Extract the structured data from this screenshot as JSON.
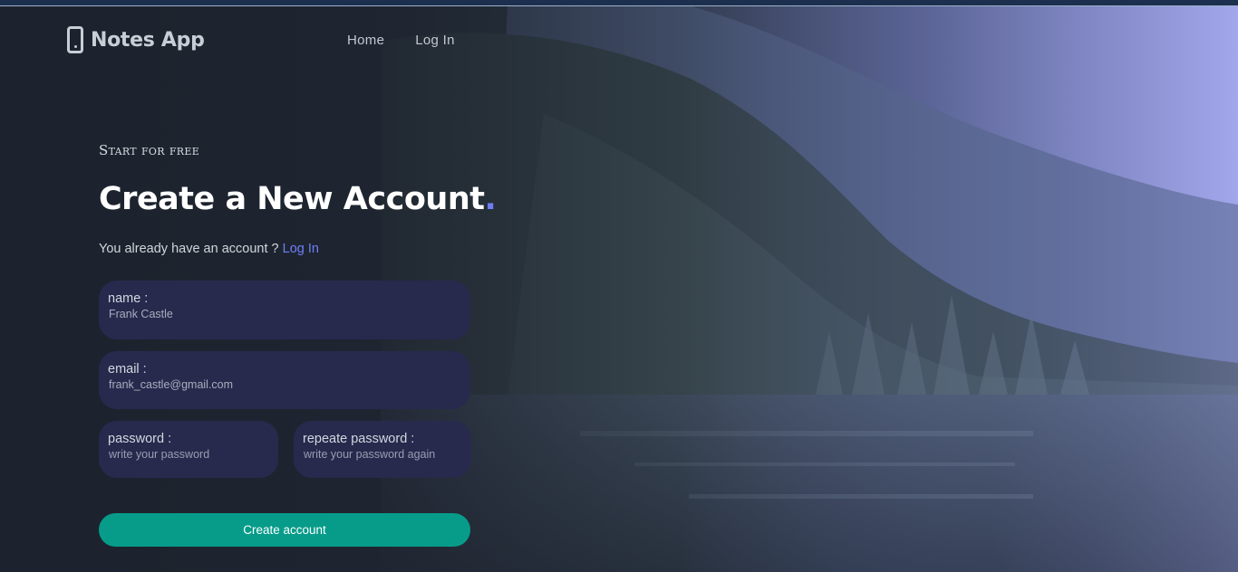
{
  "nav": {
    "brand": "Notes App",
    "brand_icon": "mobile-phone-icon",
    "links": [
      "Home",
      "Log In"
    ]
  },
  "hero": {
    "eyebrow": "Start for free",
    "title": "Create a New Account",
    "title_dot": ".",
    "subtitle_text": "You already have an account ?",
    "subtitle_link": "Log In"
  },
  "form": {
    "name": {
      "label": "name :",
      "value": "Frank Castle",
      "placeholder": ""
    },
    "email": {
      "label": "email :",
      "value": "frank_castle@gmail.com",
      "placeholder": ""
    },
    "password": {
      "label": "password :",
      "value": "",
      "placeholder": "write your password"
    },
    "repeat_password": {
      "label": "repeate password :",
      "value": "",
      "placeholder": "write your password again"
    },
    "submit_label": "Create account"
  },
  "colors": {
    "accent_link": "#6f7ff7",
    "field_bg": "#272a4d",
    "button_bg": "#079c8a",
    "title_dot": "#6f7cf2"
  }
}
